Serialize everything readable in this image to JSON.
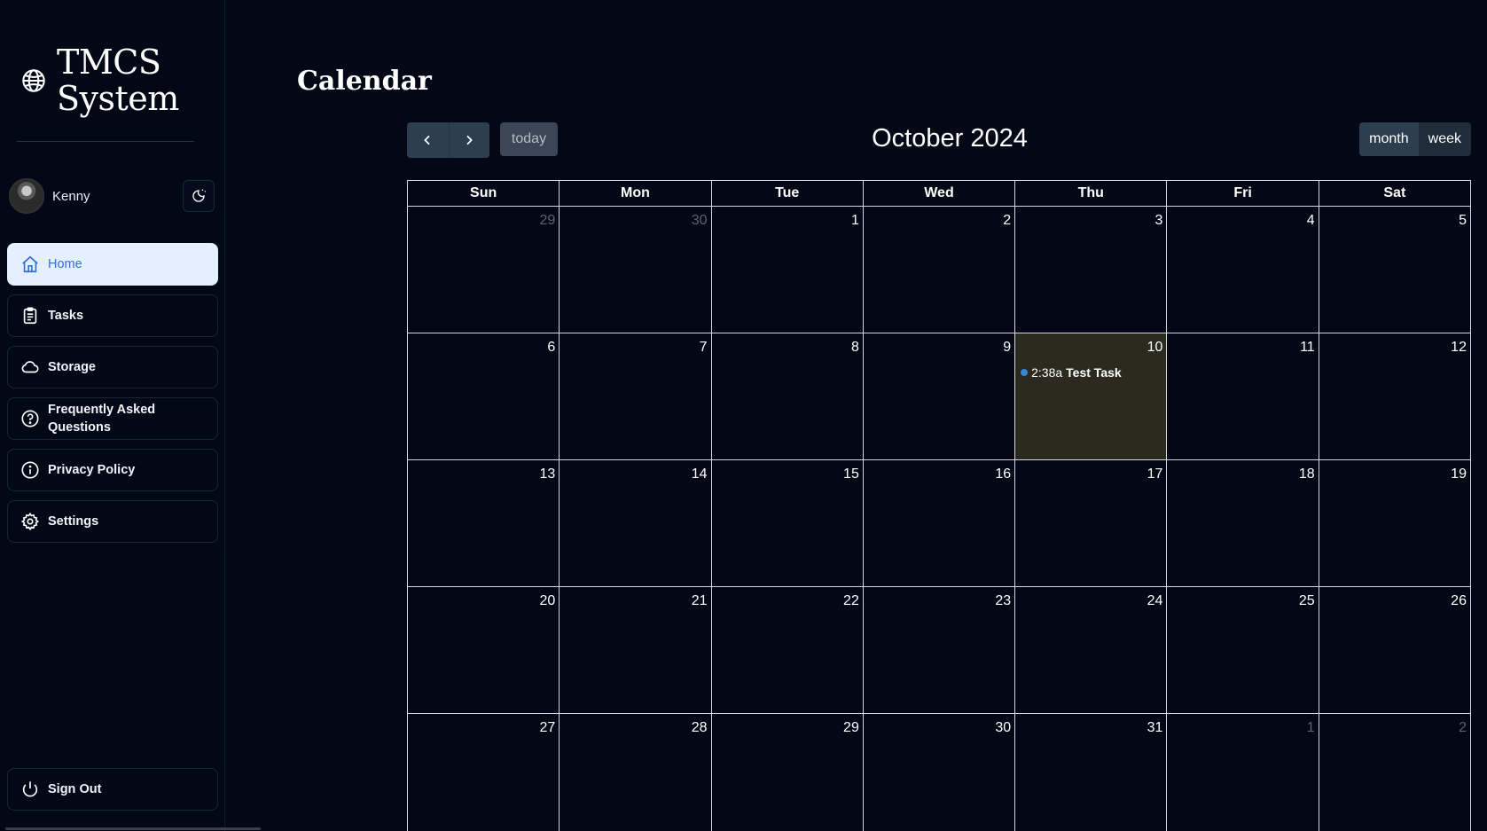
{
  "brand": {
    "line1": "TMCS",
    "line2": "System",
    "icon": "globe-icon"
  },
  "user": {
    "name": "Kenny",
    "theme_icon": "moon-sun-icon"
  },
  "nav": [
    {
      "label": "Home",
      "icon": "home-icon",
      "active": true
    },
    {
      "label": "Tasks",
      "icon": "clipboard-icon",
      "active": false
    },
    {
      "label": "Storage",
      "icon": "cloud-icon",
      "active": false
    },
    {
      "label": "Frequently Asked Questions",
      "icon": "help-circle-icon",
      "active": false
    },
    {
      "label": "Privacy Policy",
      "icon": "info-circle-icon",
      "active": false
    },
    {
      "label": "Settings",
      "icon": "gear-icon",
      "active": false
    }
  ],
  "signout": {
    "label": "Sign Out",
    "icon": "power-icon"
  },
  "page": {
    "title": "Calendar"
  },
  "calendar": {
    "title": "October 2024",
    "today_label": "today",
    "views": [
      "month",
      "week"
    ],
    "weekdays": [
      "Sun",
      "Mon",
      "Tue",
      "Wed",
      "Thu",
      "Fri",
      "Sat"
    ],
    "weeks": [
      [
        {
          "d": "29",
          "other": true
        },
        {
          "d": "30",
          "other": true
        },
        {
          "d": "1"
        },
        {
          "d": "2"
        },
        {
          "d": "3"
        },
        {
          "d": "4"
        },
        {
          "d": "5"
        }
      ],
      [
        {
          "d": "6"
        },
        {
          "d": "7"
        },
        {
          "d": "8"
        },
        {
          "d": "9"
        },
        {
          "d": "10",
          "today": true
        },
        {
          "d": "11"
        },
        {
          "d": "12"
        }
      ],
      [
        {
          "d": "13"
        },
        {
          "d": "14"
        },
        {
          "d": "15"
        },
        {
          "d": "16"
        },
        {
          "d": "17"
        },
        {
          "d": "18"
        },
        {
          "d": "19"
        }
      ],
      [
        {
          "d": "20"
        },
        {
          "d": "21"
        },
        {
          "d": "22"
        },
        {
          "d": "23"
        },
        {
          "d": "24"
        },
        {
          "d": "25"
        },
        {
          "d": "26"
        }
      ],
      [
        {
          "d": "27"
        },
        {
          "d": "28"
        },
        {
          "d": "29"
        },
        {
          "d": "30"
        },
        {
          "d": "31"
        },
        {
          "d": "1",
          "other": true
        },
        {
          "d": "2",
          "other": true
        }
      ]
    ],
    "events": [
      {
        "date": "10",
        "time": "2:38a",
        "title": "Test Task",
        "color": "#3788d8"
      }
    ]
  },
  "colors": {
    "background": "#030816",
    "active_nav_bg": "#e4f0fd",
    "active_nav_text": "#2f6fd8",
    "today_bg": "#2a2a1f",
    "button_bg": "#2c3e50"
  }
}
